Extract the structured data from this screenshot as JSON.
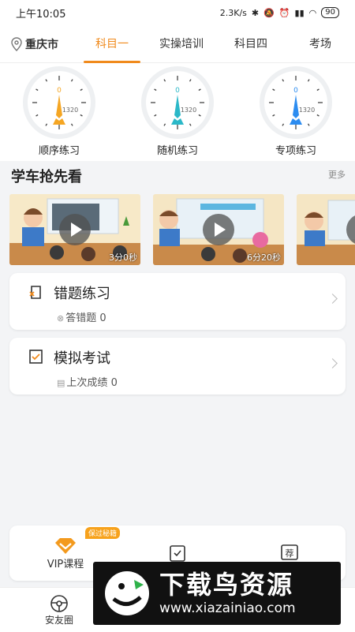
{
  "status_bar": {
    "time": "上午10:05",
    "speed": "2.3K/s",
    "battery": "90"
  },
  "top_nav": {
    "city": "重庆市",
    "tabs": [
      "科目一",
      "实操培训",
      "科目四",
      "考场"
    ],
    "active_tab": 0
  },
  "gauges": [
    {
      "label": "顺序练习",
      "count": "0",
      "total": "1320",
      "color": "#f5a623"
    },
    {
      "label": "随机练习",
      "count": "0",
      "total": "1320",
      "color": "#2bb8c8"
    },
    {
      "label": "专项练习",
      "count": "0",
      "total": "1320",
      "color": "#2c8cf0"
    }
  ],
  "preview_section": {
    "title": "学车抢先看",
    "more": "更多",
    "videos": [
      {
        "duration": "3分0秒"
      },
      {
        "duration": "6分20秒"
      },
      {
        "duration": ""
      }
    ]
  },
  "cards": [
    {
      "title": "错题练习",
      "sub_label": "答错题",
      "sub_value": "0"
    },
    {
      "title": "模拟考试",
      "sub_label": "上次成绩",
      "sub_value": "0"
    }
  ],
  "bottom_panel": {
    "vip_label": "VIP课程",
    "vip_badge": "保过秘籍"
  },
  "tab_bar": {
    "first": "安友圈"
  },
  "watermark": {
    "title": "下载鸟资源",
    "url": "www.xiazainiao.com"
  },
  "colors": {
    "accent": "#f08a1c"
  }
}
